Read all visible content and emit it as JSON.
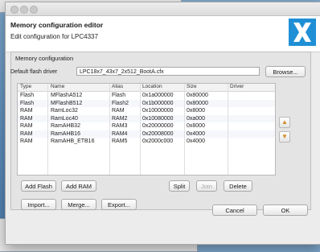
{
  "header": {
    "title": "Memory configuration editor",
    "subtitle": "Edit configuration for LPC4337",
    "logo_letter": "X"
  },
  "panel": {
    "title": "Memory configuration"
  },
  "flash_driver": {
    "label": "Default flash driver",
    "value": "LPC18x7_43x7_2x512_BootA.cfx",
    "browse": "Browse..."
  },
  "table": {
    "columns": [
      "Type",
      "Name",
      "Alias",
      "Location",
      "Size",
      "Driver"
    ],
    "rows": [
      {
        "type": "Flash",
        "name": "MFlashA512",
        "alias": "Flash",
        "location": "0x1a000000",
        "size": "0x80000",
        "driver": ""
      },
      {
        "type": "Flash",
        "name": "MFlashB512",
        "alias": "Flash2",
        "location": "0x1b000000",
        "size": "0x80000",
        "driver": ""
      },
      {
        "type": "RAM",
        "name": "RamLoc32",
        "alias": "RAM",
        "location": "0x10000000",
        "size": "0x8000",
        "driver": ""
      },
      {
        "type": "RAM",
        "name": "RamLoc40",
        "alias": "RAM2",
        "location": "0x10080000",
        "size": "0xa000",
        "driver": ""
      },
      {
        "type": "RAM",
        "name": "RamAHB32",
        "alias": "RAM3",
        "location": "0x20000000",
        "size": "0x8000",
        "driver": ""
      },
      {
        "type": "RAM",
        "name": "RamAHB16",
        "alias": "RAM4",
        "location": "0x20008000",
        "size": "0x4000",
        "driver": ""
      },
      {
        "type": "RAM",
        "name": "RamAHB_ETB16",
        "alias": "RAM5",
        "location": "0x2000c000",
        "size": "0x4000",
        "driver": ""
      }
    ]
  },
  "buttons": {
    "add_flash": "Add Flash",
    "add_ram": "Add RAM",
    "split": "Split",
    "join": "Join",
    "delete": "Delete",
    "import": "Import...",
    "merge": "Merge...",
    "export": "Export...",
    "cancel": "Cancel",
    "ok": "OK"
  },
  "icons": {
    "move_up": "arrow-up-icon",
    "move_down": "arrow-down-icon",
    "accent": "#1f8fd6"
  }
}
